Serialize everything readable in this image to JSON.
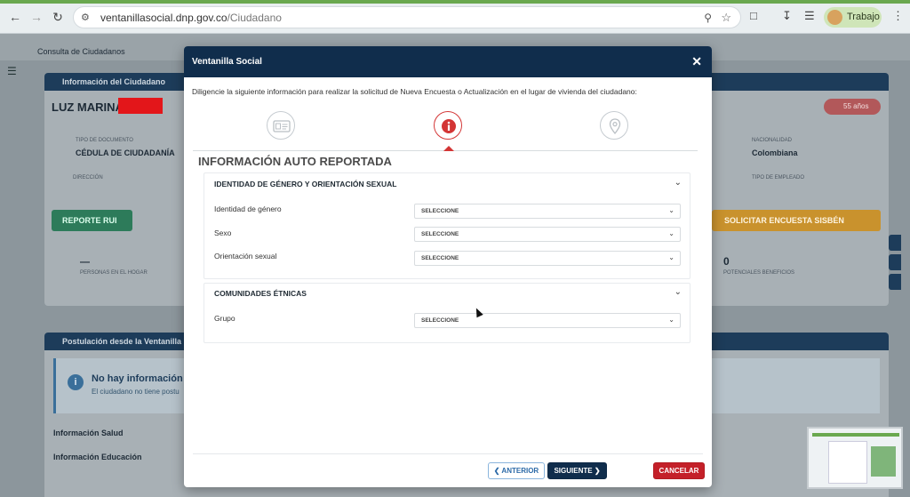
{
  "browser": {
    "url_domain": "ventanillasocial.dnp.gov.co",
    "url_path": "/Ciudadano",
    "profile_label": "Trabajo"
  },
  "background": {
    "breadcrumb": "Consulta de Ciudadanos",
    "info_card_title": "Información del Ciudadano",
    "citizen_name": "LUZ MARINA",
    "age_badge": "55 años",
    "doc_type_label": "TIPO DE DOCUMENTO",
    "doc_type_value": "CÉDULA DE CIUDADANÍA",
    "address_label": "DIRECCIÓN",
    "nationality_label": "NACIONALIDAD",
    "nationality_value": "Colombiana",
    "employment_label": "TIPO DE EMPLEADO",
    "report_button": "REPORTE RUI",
    "sisben_button": "SOLICITAR ENCUESTA SISBÉN",
    "household_count": "—",
    "household_label": "PERSONAS EN EL HOGAR",
    "beneficiaries_count": "0",
    "beneficiaries_label": "POTENCIALES BENEFICIOS",
    "postulation_title": "Postulación desde la Ventanilla",
    "no_info_title": "No hay información r",
    "no_info_sub": "El ciudadano no tiene postu",
    "health_section": "Información Salud",
    "education_section": "Información Educación"
  },
  "modal": {
    "title": "Ventanilla Social",
    "intro": "Diligencie la siguiente información para realizar la solicitud de Nueva Encuesta o Actualización en el lugar de vivienda del ciudadano:",
    "section_title": "INFORMACIÓN AUTO REPORTADA",
    "panels": [
      {
        "title": "IDENTIDAD DE GÉNERO Y ORIENTACIÓN SEXUAL",
        "fields": [
          {
            "label": "Identidad de género",
            "value": "SELECCIONE"
          },
          {
            "label": "Sexo",
            "value": "SELECCIONE"
          },
          {
            "label": "Orientación sexual",
            "value": "SELECCIONE"
          }
        ]
      },
      {
        "title": "COMUNIDADES ÉTNICAS",
        "fields": [
          {
            "label": "Grupo",
            "value": "SELECCIONE"
          }
        ]
      }
    ],
    "buttons": {
      "prev": "ANTERIOR",
      "next": "SIGUIENTE",
      "cancel": "CANCELAR"
    }
  },
  "icons": {
    "steps": [
      "id-card-icon",
      "info-icon",
      "location-pin-icon"
    ],
    "active_step": 1,
    "accent_color": "#d33535",
    "brand_color": "#102d4c"
  }
}
